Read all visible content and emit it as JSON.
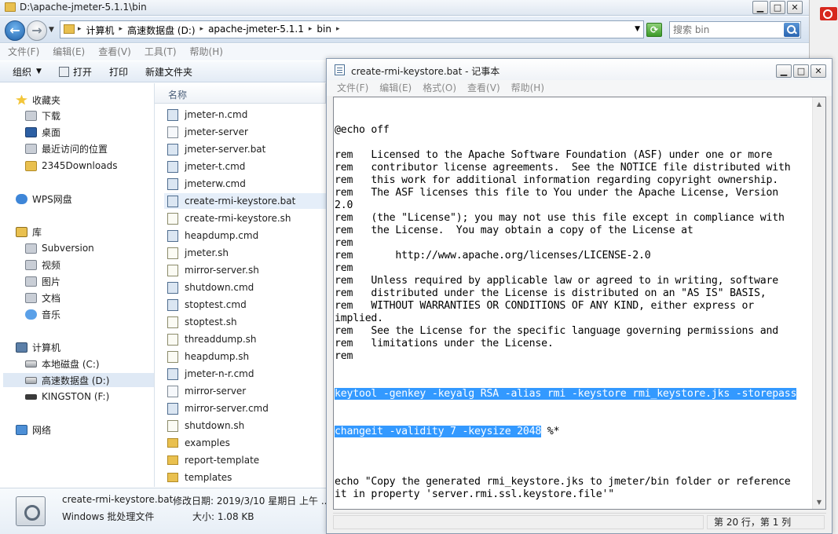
{
  "explorer": {
    "title": "D:\\apache-jmeter-5.1.1\\bin",
    "breadcrumbs": [
      "计算机",
      "高速数据盘 (D:)",
      "apache-jmeter-5.1.1",
      "bin"
    ],
    "search_placeholder": "搜索 bin",
    "menu": [
      "文件(F)",
      "编辑(E)",
      "查看(V)",
      "工具(T)",
      "帮助(H)"
    ],
    "toolbar": {
      "organize": "组织",
      "open": "打开",
      "print": "打印",
      "new_folder": "新建文件夹"
    },
    "nav": {
      "favorites": "收藏夹",
      "downloads": "下载",
      "desktop": "桌面",
      "recent": "最近访问的位置",
      "downloads2345": "2345Downloads",
      "wps": "WPS网盘",
      "library": "库",
      "subversion": "Subversion",
      "video": "视频",
      "pictures": "图片",
      "documents": "文档",
      "music": "音乐",
      "computer": "计算机",
      "local_c": "本地磁盘 (C:)",
      "drive_d": "高速数据盘 (D:)",
      "kingston": "KINGSTON (F:)",
      "network": "网络"
    },
    "column_name": "名称",
    "files": [
      {
        "name": "jmeter-n.cmd",
        "type": "bat"
      },
      {
        "name": "jmeter-server",
        "type": "plain"
      },
      {
        "name": "jmeter-server.bat",
        "type": "bat"
      },
      {
        "name": "jmeter-t.cmd",
        "type": "bat"
      },
      {
        "name": "jmeterw.cmd",
        "type": "bat"
      },
      {
        "name": "create-rmi-keystore.bat",
        "type": "bat"
      },
      {
        "name": "create-rmi-keystore.sh",
        "type": "sh"
      },
      {
        "name": "heapdump.cmd",
        "type": "bat"
      },
      {
        "name": "jmeter.sh",
        "type": "sh"
      },
      {
        "name": "mirror-server.sh",
        "type": "sh"
      },
      {
        "name": "shutdown.cmd",
        "type": "bat"
      },
      {
        "name": "stoptest.cmd",
        "type": "bat"
      },
      {
        "name": "stoptest.sh",
        "type": "sh"
      },
      {
        "name": "threaddump.sh",
        "type": "sh"
      },
      {
        "name": "heapdump.sh",
        "type": "sh"
      },
      {
        "name": "jmeter-n-r.cmd",
        "type": "bat"
      },
      {
        "name": "mirror-server",
        "type": "plain"
      },
      {
        "name": "mirror-server.cmd",
        "type": "bat"
      },
      {
        "name": "shutdown.sh",
        "type": "sh"
      },
      {
        "name": "examples",
        "type": "dir"
      },
      {
        "name": "report-template",
        "type": "dir"
      },
      {
        "name": "templates",
        "type": "dir"
      }
    ],
    "details": {
      "filename": "create-rmi-keystore.bat",
      "modified": "修改日期: 2019/3/10 星期日 上午 ...",
      "filetype": "Windows 批处理文件",
      "size": "大小: 1.08 KB"
    }
  },
  "notepad": {
    "title": "create-rmi-keystore.bat - 记事本",
    "menu": [
      "文件(F)",
      "编辑(E)",
      "格式(O)",
      "查看(V)",
      "帮助(H)"
    ],
    "lines": [
      "@echo off",
      "",
      "rem   Licensed to the Apache Software Foundation (ASF) under one or more",
      "rem   contributor license agreements.  See the NOTICE file distributed with",
      "rem   this work for additional information regarding copyright ownership.",
      "rem   The ASF licenses this file to You under the Apache License, Version",
      "2.0",
      "rem   (the \"License\"); you may not use this file except in compliance with",
      "rem   the License.  You may obtain a copy of the License at",
      "rem",
      "rem       http://www.apache.org/licenses/LICENSE-2.0",
      "rem",
      "rem   Unless required by applicable law or agreed to in writing, software",
      "rem   distributed under the License is distributed on an \"AS IS\" BASIS,",
      "rem   WITHOUT WARRANTIES OR CONDITIONS OF ANY KIND, either express or",
      "implied.",
      "rem   See the License for the specific language governing permissions and",
      "rem   limitations under the License.",
      "rem"
    ],
    "selected_line1": "keytool -genkey -keyalg RSA -alias rmi -keystore rmi_keystore.jks -storepass",
    "selected_line2": "changeit -validity 7 -keysize 2048",
    "after_selection": " %*",
    "tail_lines": [
      "",
      "echo \"Copy the generated rmi_keystore.jks to jmeter/bin folder or reference",
      "it in property 'server.rmi.ssl.keystore.file'\""
    ],
    "status": "第 20 行，第 1 列"
  }
}
